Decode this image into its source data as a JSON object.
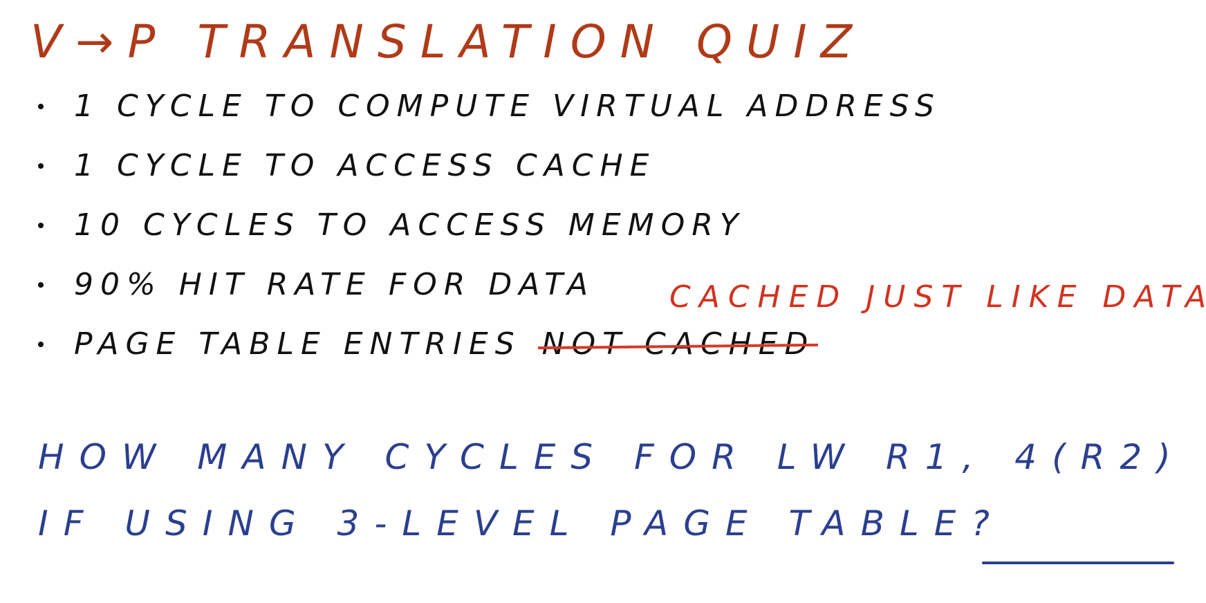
{
  "title": "V→P TRANSLATION QUIZ",
  "bullets": [
    "1 CYCLE TO COMPUTE VIRTUAL ADDRESS",
    "1 CYCLE TO ACCESS CACHE",
    "10 CYCLES TO ACCESS MEMORY",
    "90% HIT RATE FOR DATA"
  ],
  "page_table_bullet": {
    "text": "PAGE TABLE ENTRIES",
    "struck_text": "NOT CACHED",
    "replacement": "CACHED JUST LIKE DATA"
  },
  "question": {
    "line1": "HOW MANY CYCLES FOR LW R1, 4(R2)",
    "line2": "IF USING 3-LEVEL PAGE TABLE?"
  },
  "colors": {
    "title": "#b03a18",
    "body": "#111111",
    "correction": "#d2321f",
    "question": "#2b3f8f"
  }
}
